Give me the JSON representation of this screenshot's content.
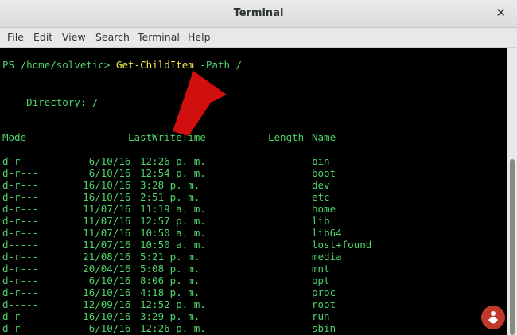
{
  "window": {
    "title": "Terminal"
  },
  "menu": [
    "File",
    "Edit",
    "View",
    "Search",
    "Terminal",
    "Help"
  ],
  "terminal": {
    "prompt": "PS /home/solvetic> ",
    "command": "Get-ChildItem",
    "args": " -Path /",
    "directory_label": "    Directory: /",
    "header": {
      "mode": "Mode",
      "lastwrite": "LastWriteTime",
      "length": "Length",
      "name": "Name"
    },
    "separator": {
      "mode": "----",
      "lastwrite": "-------------",
      "length": "------",
      "name": "----"
    },
    "rows": [
      {
        "mode": "d-r---",
        "date": "6/10/16",
        "time": "12:26 p. m.",
        "name": "bin"
      },
      {
        "mode": "d-r---",
        "date": "6/10/16",
        "time": "12:54 p. m.",
        "name": "boot"
      },
      {
        "mode": "d-r---",
        "date": "16/10/16",
        "time": "3:28 p. m.",
        "name": "dev"
      },
      {
        "mode": "d-r---",
        "date": "16/10/16",
        "time": "2:51 p. m.",
        "name": "etc"
      },
      {
        "mode": "d-r---",
        "date": "11/07/16",
        "time": "11:19 a. m.",
        "name": "home"
      },
      {
        "mode": "d-r---",
        "date": "11/07/16",
        "time": "12:57 p. m.",
        "name": "lib"
      },
      {
        "mode": "d-r---",
        "date": "11/07/16",
        "time": "10:50 a. m.",
        "name": "lib64"
      },
      {
        "mode": "d-----",
        "date": "11/07/16",
        "time": "10:50 a. m.",
        "name": "lost+found"
      },
      {
        "mode": "d-r---",
        "date": "21/08/16",
        "time": "5:21 p. m.",
        "name": "media"
      },
      {
        "mode": "d-r---",
        "date": "20/04/16",
        "time": "5:08 p. m.",
        "name": "mnt"
      },
      {
        "mode": "d-r---",
        "date": "6/10/16",
        "time": "8:06 p. m.",
        "name": "opt"
      },
      {
        "mode": "d-r---",
        "date": "16/10/16",
        "time": "4:18 p. m.",
        "name": "proc"
      },
      {
        "mode": "d-----",
        "date": "12/09/16",
        "time": "12:52 p. m.",
        "name": "root"
      },
      {
        "mode": "d-r---",
        "date": "16/10/16",
        "time": "3:29 p. m.",
        "name": "run"
      },
      {
        "mode": "d-r---",
        "date": "6/10/16",
        "time": "12:26 p. m.",
        "name": "sbin"
      }
    ]
  },
  "colors": {
    "text": "#4fd36a",
    "command": "#f2e84b",
    "arrow": "#d10f0f",
    "background": "#000000"
  },
  "icons": {
    "close": "close-icon",
    "arrow": "red-arrow-annotation",
    "logo": "solvetic-logo"
  }
}
